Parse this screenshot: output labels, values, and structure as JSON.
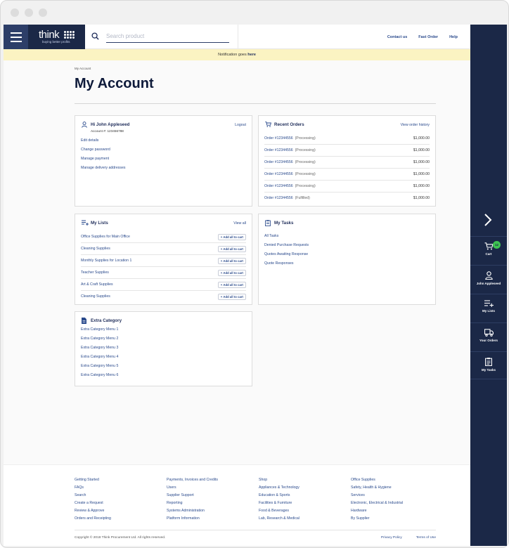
{
  "header": {
    "logo_word": "think",
    "logo_tagline": "buying better profits",
    "search_placeholder": "Search product",
    "links": [
      "Contact us",
      "Fast Order",
      "Help"
    ]
  },
  "notification": {
    "text": "Notification goes ",
    "link": "here"
  },
  "breadcrumb": "My Account",
  "page_title": "My Account",
  "account": {
    "greeting": "Hi John Appleseed",
    "account_no": "Account #: 123456788",
    "logout": "Logout",
    "links": [
      "Edit details",
      "Change password",
      "Manage payment",
      "Manage delivery addresses"
    ]
  },
  "recent_orders": {
    "title": "Recent Orders",
    "view_link": "View order history",
    "rows": [
      {
        "id": "Order #12344556",
        "status": "(Processing)",
        "price": "$1,000.00"
      },
      {
        "id": "Order #12344556",
        "status": "(Processing)",
        "price": "$1,000.00"
      },
      {
        "id": "Order #12344556",
        "status": "(Processing)",
        "price": "$1,000.00"
      },
      {
        "id": "Order #12344556",
        "status": "(Processing)",
        "price": "$1,000.00"
      },
      {
        "id": "Order #12344556",
        "status": "(Processing)",
        "price": "$1,000.00"
      },
      {
        "id": "Order #12344556",
        "status": "(Fulfilled)",
        "price": "$1,000.00"
      }
    ]
  },
  "my_lists": {
    "title": "My Lists",
    "view_link": "View all",
    "add_label": "Add all to cart",
    "items": [
      "Office Supplies for Main Office",
      "Cleaning Supplies",
      "Monthly Supplies for Location 1",
      "Teacher Supplies",
      "Art & Craft Supplies",
      "Cleaning Supplies"
    ]
  },
  "my_tasks": {
    "title": "My Tasks",
    "items": [
      "All Tasks",
      "Denied Purchase Requests",
      "Quotes Awaiting Response",
      "Quote Responses"
    ]
  },
  "extra_category": {
    "title": "Extra Category",
    "items": [
      "Extra Category Menu 1",
      "Extra Category Menu 2",
      "Extra Category Menu 3",
      "Extra Category Menu 4",
      "Extra Category Menu 5",
      "Extra Category Menu 6"
    ]
  },
  "rail": {
    "cart_label": "Cart",
    "cart_count": "12",
    "user_label": "John Appleseed",
    "lists_label": "My Lists",
    "orders_label": "Your Orders",
    "tasks_label": "My Tasks"
  },
  "footer": {
    "col1": [
      "Getting Started",
      "FAQs",
      "Search",
      "Create a Request",
      "Review & Approve",
      "Orders and Receipting"
    ],
    "col2": [
      "Payments, Invoices and Credits",
      "Users",
      "Supplier Support",
      "Reporting",
      "Systems Administration",
      "Platform Information"
    ],
    "col3": [
      "Shop",
      "Appliances & Technology",
      "Education & Sports",
      "Facilities & Furniture",
      "Food & Beverages",
      "Lab, Research & Medical"
    ],
    "col4": [
      "Office Supplies",
      "Safety, Health & Hygiene",
      "Services",
      "Electronic, Electrical & Industrial",
      "Hardware",
      "By Supplier"
    ],
    "copyright": "Copyright © 2018 Think Procurement Ltd. All rights reserved.",
    "privacy": "Privacy Policy",
    "terms": "Terms of Use"
  },
  "colors": {
    "navy": "#1b2847",
    "accent": "#2a4a8c",
    "notification_bg": "#fbf3c2",
    "badge": "#3ec452"
  }
}
